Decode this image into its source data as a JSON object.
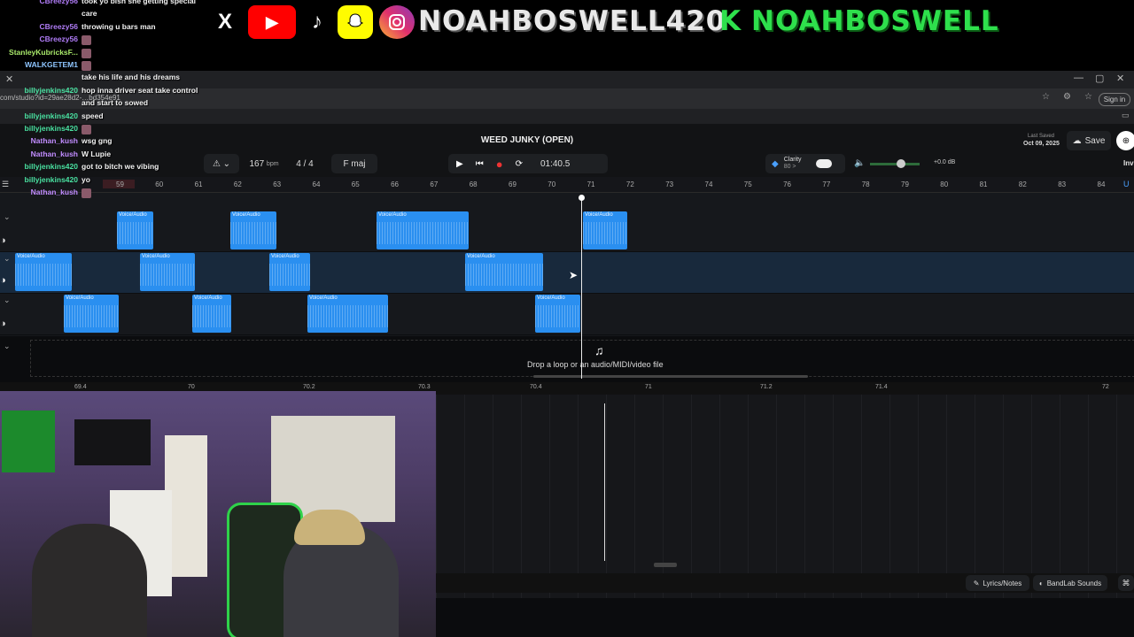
{
  "banner": {
    "x_icon": "X",
    "handle": "NOAHBOSWELL420",
    "kick_letter": "K",
    "kick_handle": "NOAHBOSWELL"
  },
  "browser": {
    "url": "com/studio?id=29ae28d2-…bd354e91",
    "sign_in": "Sign in"
  },
  "daw": {
    "project_title": "WEED JUNKY (OPEN)",
    "bpm": "167",
    "bpm_unit": "bpm",
    "time_sig": "4 / 4",
    "key": "F maj",
    "time": "01:40.5",
    "clarity": "Clarity",
    "clarity_sub": "80 >",
    "gain": "+0.0 dB",
    "last_saved_label": "Last Saved",
    "last_saved_date": "Oct 09, 2025",
    "save_label": "Save",
    "invite_label": "Inv",
    "drop_text": "Drop a loop or an audio/MIDI/video file",
    "lyrics_label": "Lyrics/Notes",
    "sounds_label": "BandLab Sounds"
  },
  "ruler": [
    "59",
    "60",
    "61",
    "62",
    "63",
    "64",
    "65",
    "66",
    "67",
    "68",
    "69",
    "70",
    "71",
    "72",
    "73",
    "74",
    "75",
    "76",
    "77",
    "78",
    "79",
    "80",
    "81",
    "82",
    "83",
    "84"
  ],
  "zoom_ruler": [
    "69.4",
    "70",
    "70.2",
    "70.3",
    "70.4",
    "71",
    "71.2",
    "71.4",
    "72"
  ],
  "clip_label": "Voice/Audio",
  "chat": [
    {
      "user": "CBreezy56",
      "text": "took yo bish she getting special",
      "color": "#b07cf7"
    },
    {
      "user": "",
      "text": "care",
      "color": "#b07cf7"
    },
    {
      "user": "CBreezy56",
      "text": "throwing u bars man",
      "color": "#b07cf7"
    },
    {
      "user": "CBreezy56",
      "text": "",
      "color": "#b07cf7"
    },
    {
      "user": "StanleyKubricksF...",
      "text": "",
      "color": "#a8e86a"
    },
    {
      "user": "WALKGETEM1",
      "text": "",
      "color": "#8fc6ff"
    },
    {
      "user": "",
      "text": "take his life and his dreams",
      "color": "#b07cf7"
    },
    {
      "user": "billyjenkins420",
      "text": "hop inna driver seat take control",
      "color": "#49e0a0"
    },
    {
      "user": "",
      "text": "and start to sowed",
      "color": "#49e0a0"
    },
    {
      "user": "billyjenkins420",
      "text": "speed",
      "color": "#49e0a0"
    },
    {
      "user": "billyjenkins420",
      "text": "",
      "color": "#49e0a0"
    },
    {
      "user": "Nathan_kush",
      "text": "wsg gng",
      "color": "#c18cff"
    },
    {
      "user": "Nathan_kush",
      "text": "W Lupie",
      "color": "#c18cff"
    },
    {
      "user": "billyjenkins420",
      "text": "got to bitch we vibing",
      "color": "#49e0a0"
    },
    {
      "user": "billyjenkins420",
      "text": "yo",
      "color": "#49e0a0"
    },
    {
      "user": "Nathan_kush",
      "text": "",
      "color": "#c18cff"
    }
  ]
}
